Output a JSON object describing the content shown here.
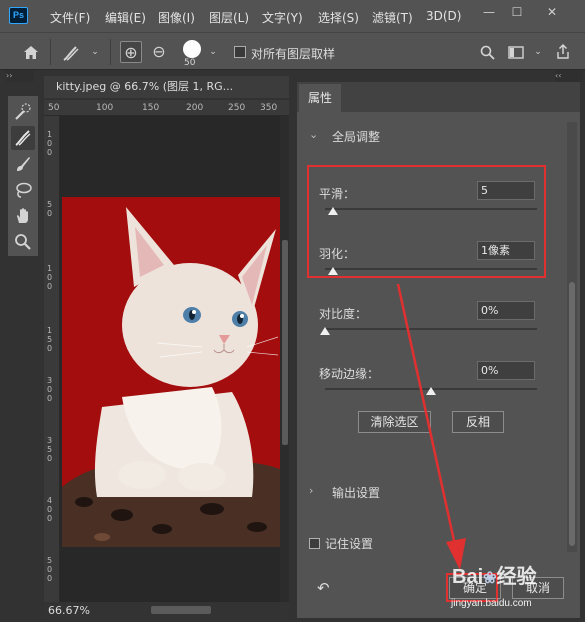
{
  "app": {
    "logo": "Ps"
  },
  "menu": [
    "文件(F)",
    "编辑(E)",
    "图像(I)",
    "图层(L)",
    "文字(Y)",
    "选择(S)",
    "滤镜(T)",
    "3D(D)"
  ],
  "window_controls": [
    "minimize-icon",
    "maximize-icon",
    "close-icon"
  ],
  "options": {
    "brush_size": "50",
    "sample_all_layers_label": "对所有图层取样",
    "sample_all_layers_checked": false
  },
  "document": {
    "tab_title": "kitty.jpeg @ 66.7% (图层 1, RG...",
    "ruler_ticks": [
      "50",
      "100",
      "150",
      "200",
      "250",
      "350"
    ],
    "zoom": "66.67%",
    "image_background": "#a30d0d"
  },
  "properties": {
    "tab": "属性",
    "global_section": "全局调整",
    "fields": [
      {
        "label": "平滑：",
        "value": "5"
      },
      {
        "label": "羽化：",
        "value": "1像素"
      },
      {
        "label": "对比度：",
        "value": "0%"
      },
      {
        "label": "移动边缘：",
        "value": "0%"
      }
    ],
    "levels": {
      "smooth": 0.04,
      "feather": 0.04,
      "contrast": 0.0,
      "shift_edge": 0.5
    },
    "clear_selection": "清除选区",
    "invert": "反相",
    "output_section": "输出设置",
    "remember_settings": "记住设置",
    "remember_checked": false,
    "ok": "确定",
    "cancel": "取消"
  },
  "annotation": {
    "color": "#e03030"
  },
  "watermark": {
    "brand": "Bai",
    "brand2": "经验",
    "url": "jingyan.baidu.com"
  }
}
